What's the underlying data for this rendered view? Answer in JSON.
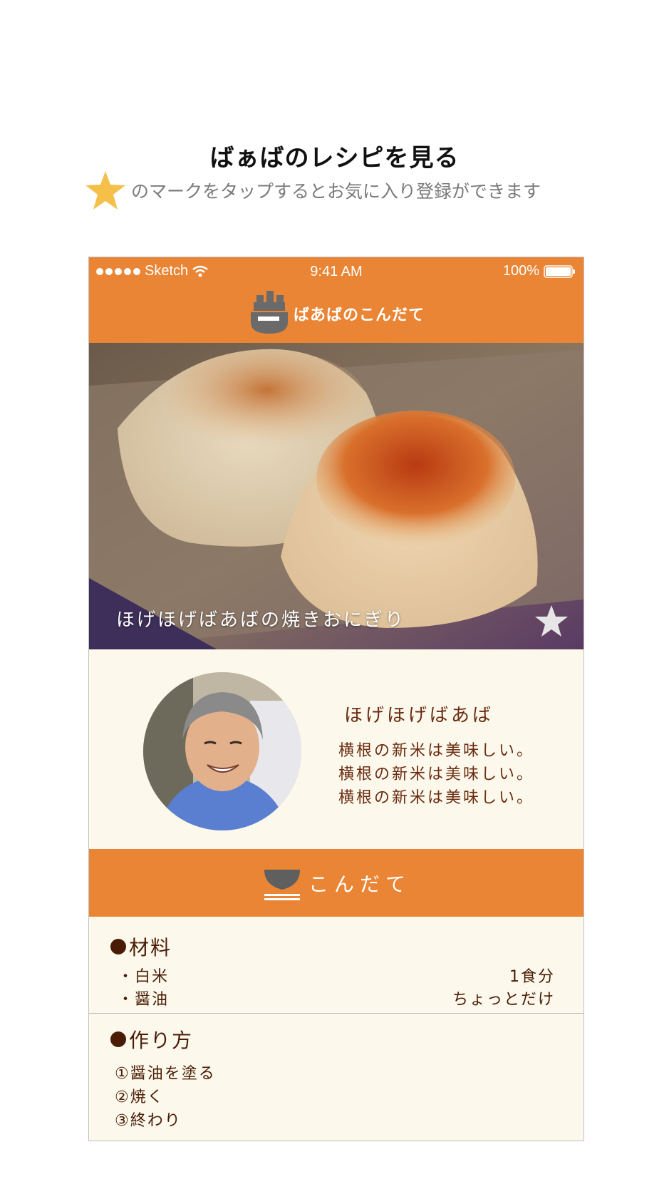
{
  "promo": {
    "title": "ばぁばのレシピを見る",
    "subtitle": "のマークをタップするとお気に入り登録ができます"
  },
  "status_bar": {
    "carrier": "Sketch",
    "time": "9:41 AM",
    "battery": "100%"
  },
  "nav": {
    "title": "ばあばのこんだて"
  },
  "hero": {
    "caption": "ほげほげばあばの焼きおにぎり"
  },
  "profile": {
    "name": "ほげほげばあば",
    "bio": [
      "横根の新米は美味しい。",
      "横根の新米は美味しい。",
      "横根の新米は美味しい。"
    ]
  },
  "menu": {
    "title": "こんだて"
  },
  "ingredients": {
    "heading": "材料",
    "items": [
      {
        "name": "・白米",
        "amount": "1食分"
      },
      {
        "name": "・醤油",
        "amount": "ちょっとだけ"
      }
    ]
  },
  "steps": {
    "heading": "作り方",
    "items": [
      "①醤油を塗る",
      "②焼く",
      "③終わり"
    ]
  },
  "colors": {
    "accent": "#e98534",
    "cream": "#fcf9ec",
    "text_brown": "#4a1c06",
    "star": "#f5c04a"
  }
}
